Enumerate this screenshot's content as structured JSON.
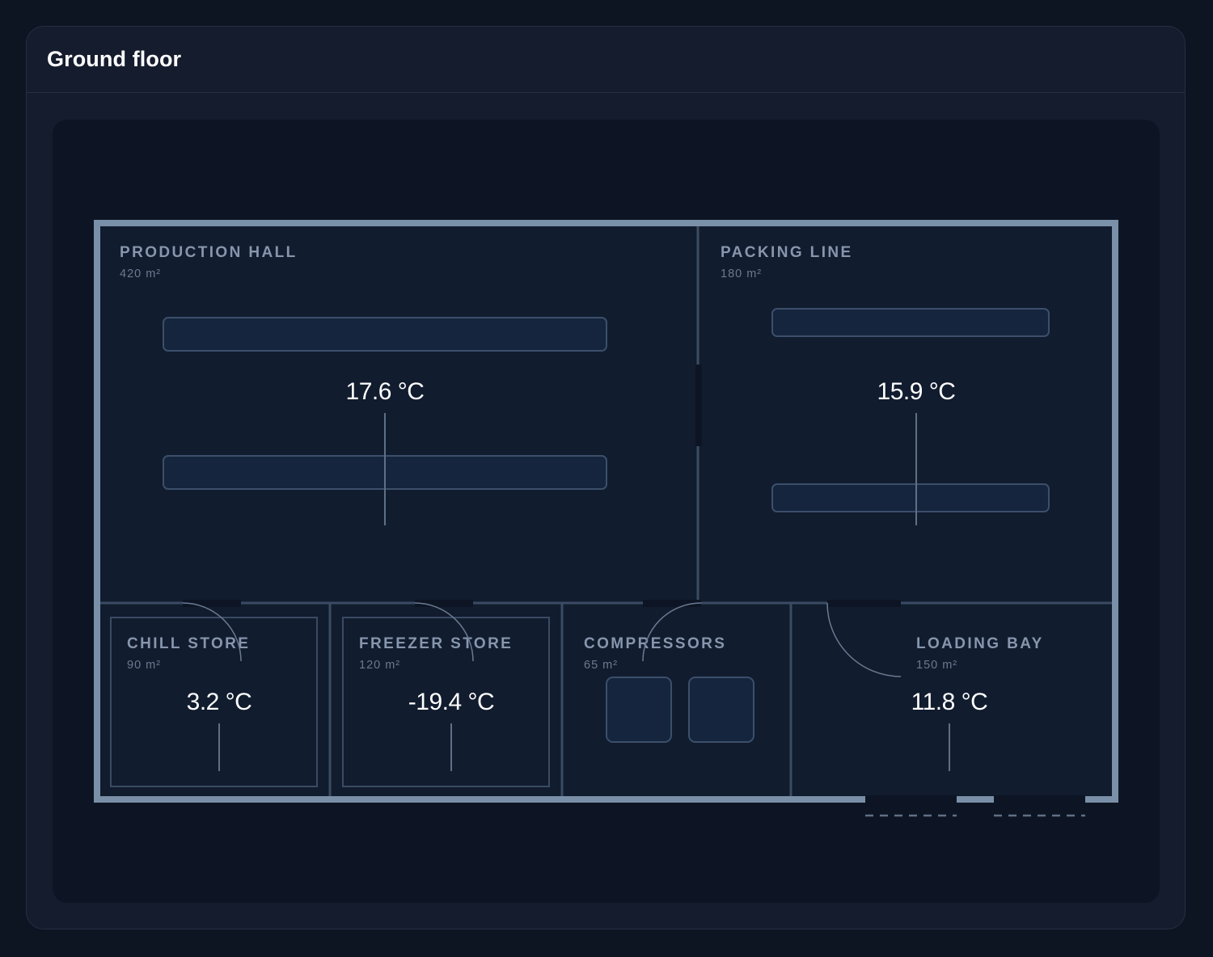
{
  "card": {
    "title": "Ground floor"
  },
  "rooms": {
    "production_hall": {
      "name": "PRODUCTION HALL",
      "area": "420 m²",
      "temperature": "17.6 °C"
    },
    "packing_line": {
      "name": "PACKING LINE",
      "area": "180 m²",
      "temperature": "15.9 °C"
    },
    "chill_store": {
      "name": "CHILL STORE",
      "area": "90 m²",
      "temperature": "3.2 °C"
    },
    "freezer_store": {
      "name": "FREEZER STORE",
      "area": "120 m²",
      "temperature": "-19.4 °C"
    },
    "compressors": {
      "name": "COMPRESSORS",
      "area": "65 m²"
    },
    "loading_bay": {
      "name": "LOADING BAY",
      "area": "150 m²",
      "temperature": "11.8 °C"
    }
  },
  "colors": {
    "outer_wall": "#7a90a8",
    "inner_wall": "#3a4b63",
    "room_fill": "#111c2e",
    "equipment_fill": "#15253d",
    "equipment_stroke": "#3b4f6b"
  }
}
